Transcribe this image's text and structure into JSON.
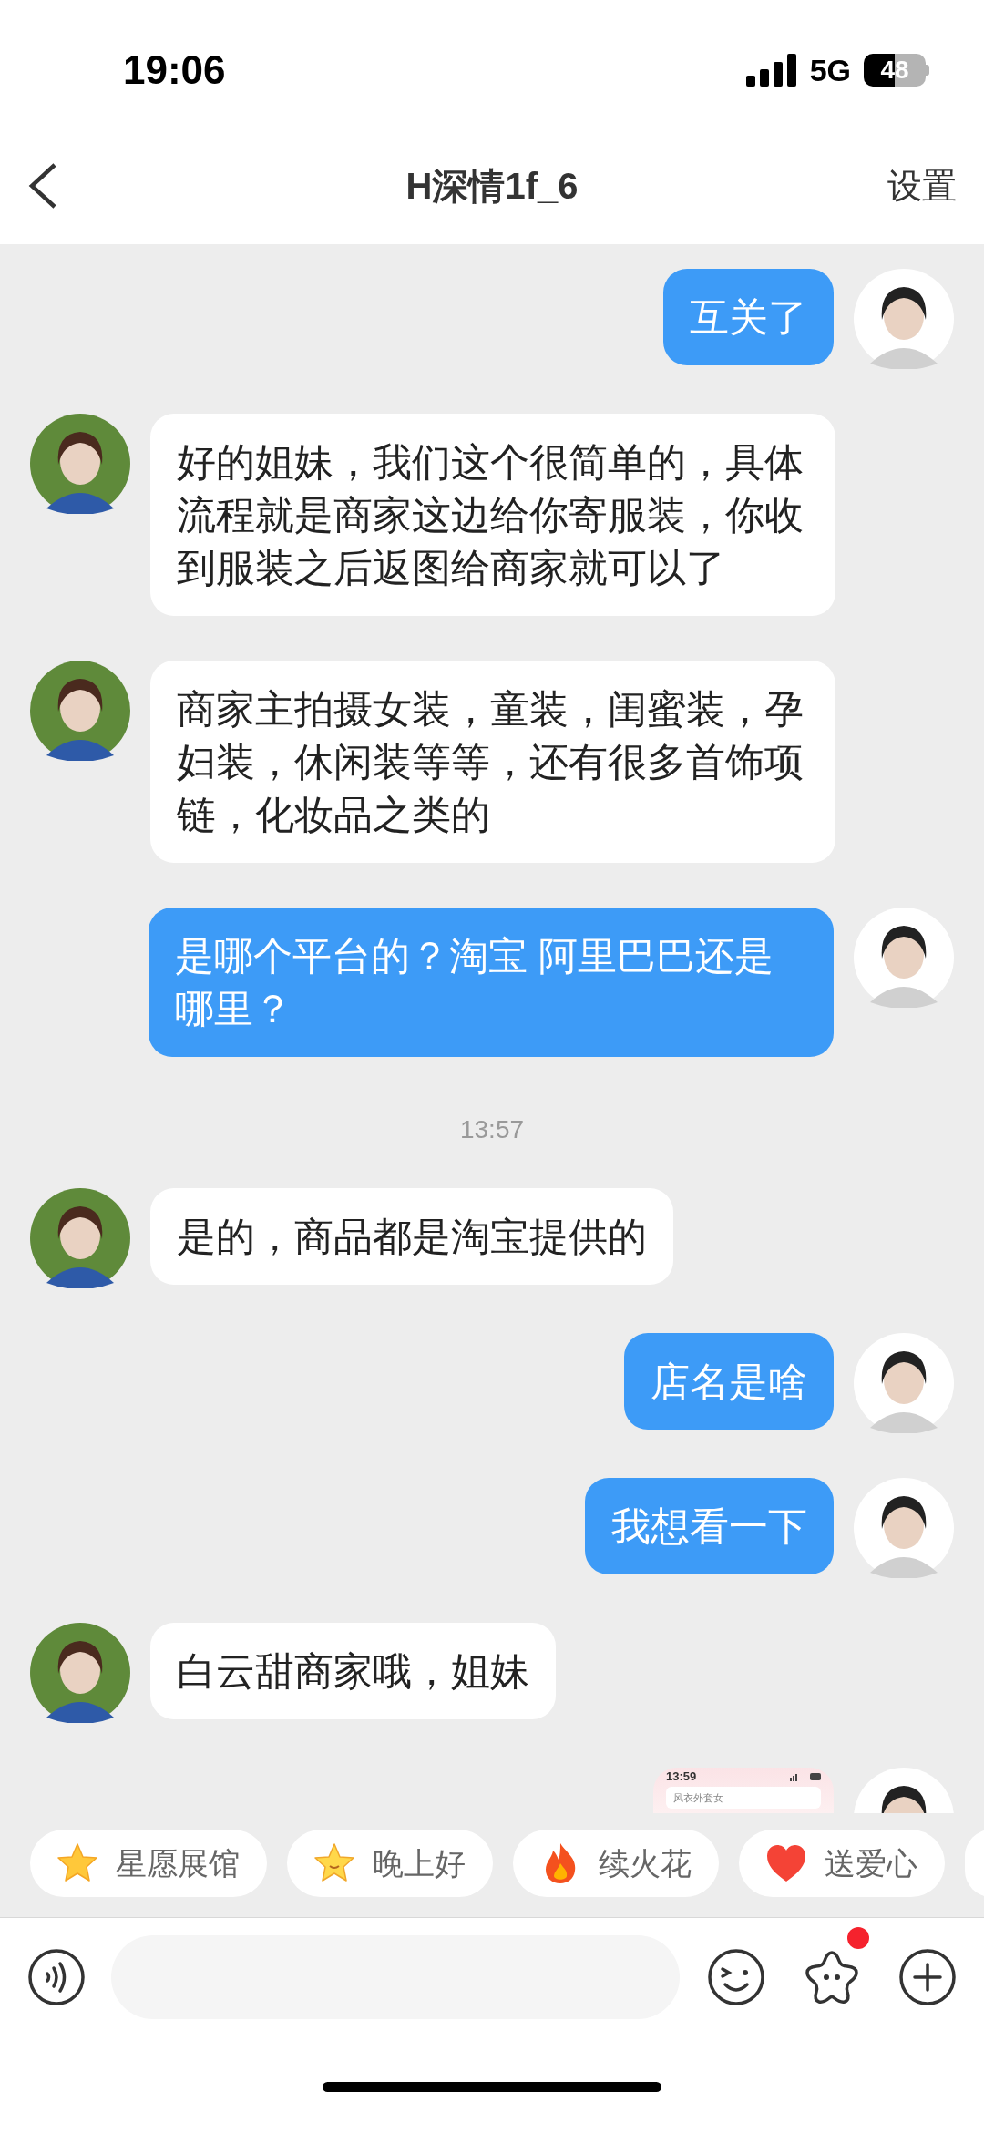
{
  "status_bar": {
    "time": "19:06",
    "network": "5G",
    "battery": "48"
  },
  "header": {
    "title": "H深情1f_6",
    "action": "设置"
  },
  "messages": [
    {
      "kind": "text",
      "outgoing": true,
      "text": "互关了"
    },
    {
      "kind": "text",
      "outgoing": false,
      "text": "好的姐妹，我们这个很简单的，具体流程就是商家这边给你寄服装，你收到服装之后返图给商家就可以了"
    },
    {
      "kind": "text",
      "outgoing": false,
      "text": "商家主拍摄女装，童装，闺蜜装，孕妇装，休闲装等等，还有很多首饰项链，化妆品之类的"
    },
    {
      "kind": "text",
      "outgoing": true,
      "text": "是哪个平台的？淘宝 阿里巴巴还是哪里？"
    },
    {
      "kind": "time",
      "text": "13:57"
    },
    {
      "kind": "text",
      "outgoing": false,
      "text": "是的，商品都是淘宝提供的"
    },
    {
      "kind": "text",
      "outgoing": true,
      "text": "店名是啥"
    },
    {
      "kind": "text",
      "outgoing": true,
      "text": "我想看一下"
    },
    {
      "kind": "text",
      "outgoing": false,
      "text": "白云甜商家哦，姐妹"
    },
    {
      "kind": "screenshot",
      "outgoing": true,
      "time": "13:59",
      "search": "风衣外套女"
    }
  ],
  "quick_replies": [
    {
      "kind": "star",
      "label": "星愿展馆"
    },
    {
      "kind": "star-smile",
      "label": "晚上好"
    },
    {
      "kind": "flame",
      "label": "续火花"
    },
    {
      "kind": "heart",
      "label": "送爱心"
    },
    {
      "kind": "partial"
    }
  ],
  "composer": {
    "sticker_badge": true
  }
}
